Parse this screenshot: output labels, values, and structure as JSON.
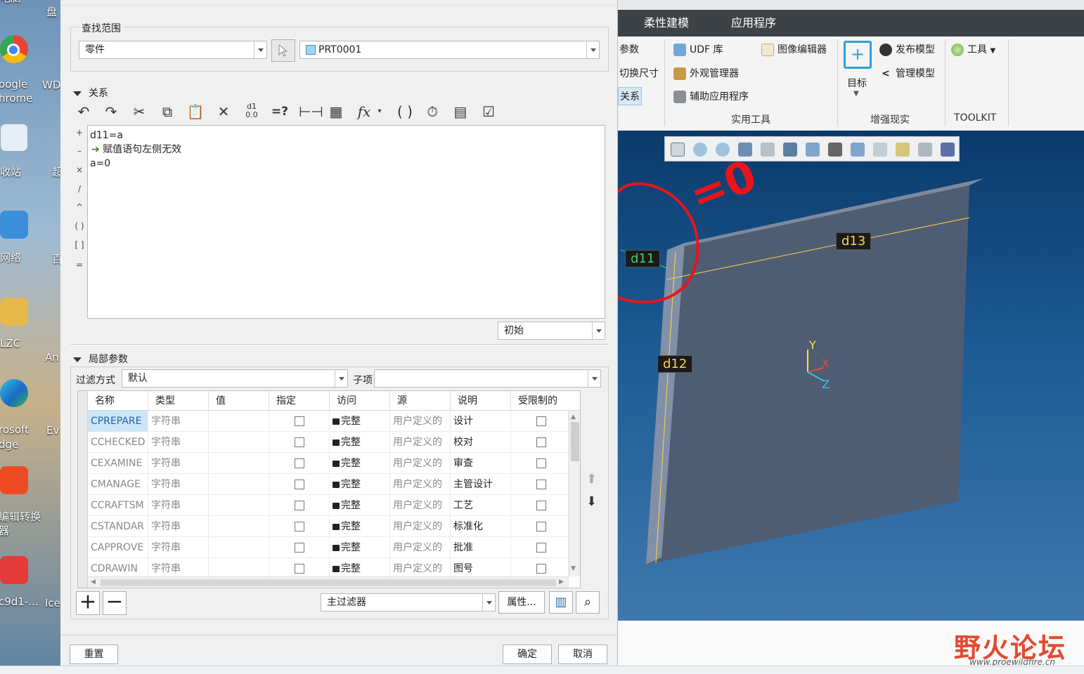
{
  "desktop": {
    "icons": [
      {
        "label": "电脑",
        "name": "desktop-icon-computer"
      },
      {
        "label": "oogle\nhrome",
        "name": "desktop-icon-chrome"
      },
      {
        "label": "收站",
        "name": "desktop-icon-recycle-bin"
      },
      {
        "label": "网络",
        "name": "desktop-icon-network"
      },
      {
        "label": "LZC",
        "name": "desktop-icon-user"
      },
      {
        "label": "rosoft\ndge",
        "name": "desktop-icon-edge"
      },
      {
        "label": "编辑转换\n器",
        "name": "desktop-icon-converter"
      },
      {
        "label": "c9d1-...",
        "name": "desktop-icon-file"
      }
    ],
    "col2": [
      "盘",
      "WD",
      "超",
      "百",
      "An",
      "Ev",
      "Ice"
    ]
  },
  "dialog": {
    "search_scope": {
      "title": "查找范围",
      "type_value": "零件",
      "model_value": "PRT0001"
    },
    "relations": {
      "title": "关系",
      "toolbar": [
        "undo-icon",
        "redo-icon",
        "cut-icon",
        "copy-icon",
        "paste-icon",
        "delete-icon",
        "insert-dims-icon",
        "evaluate-icon",
        "measure-icon",
        "sort-icon",
        "function-icon",
        "parens-icon",
        "verify-icon",
        "display-icon",
        "check-icon"
      ],
      "operators": [
        "+",
        "–",
        "×",
        "/",
        "^",
        "( )",
        "[ ]",
        "="
      ],
      "lines": [
        "d11=a",
        "赋值语句左侧无效",
        "a=0"
      ],
      "initial_value": "初始"
    },
    "local_params": {
      "title": "局部参数",
      "filter_label": "过滤方式",
      "filter_value": "默认",
      "child_label": "子项",
      "child_value": "",
      "columns": [
        "名称",
        "类型",
        "值",
        "指定",
        "访问",
        "源",
        "说明",
        "受限制的"
      ],
      "rows": [
        {
          "name": "CPREPARE",
          "type": "字符串",
          "access": "完整",
          "source": "用户定义的",
          "desc": "设计"
        },
        {
          "name": "CCHECKED",
          "type": "字符串",
          "access": "完整",
          "source": "用户定义的",
          "desc": "校对"
        },
        {
          "name": "CEXAMINE",
          "type": "字符串",
          "access": "完整",
          "source": "用户定义的",
          "desc": "审查"
        },
        {
          "name": "CMANAGE",
          "type": "字符串",
          "access": "完整",
          "source": "用户定义的",
          "desc": "主管设计"
        },
        {
          "name": "CCRAFTSM",
          "type": "字符串",
          "access": "完整",
          "source": "用户定义的",
          "desc": "工艺"
        },
        {
          "name": "CSTANDAR",
          "type": "字符串",
          "access": "完整",
          "source": "用户定义的",
          "desc": "标准化"
        },
        {
          "name": "CAPPROVE",
          "type": "字符串",
          "access": "完整",
          "source": "用户定义的",
          "desc": "批准"
        },
        {
          "name": "CDRAWIN",
          "type": "字符串",
          "access": "完整",
          "source": "用户定义的",
          "desc": "图号"
        }
      ],
      "main_filter": "主过滤器",
      "properties_label": "属性..."
    },
    "footer": {
      "reset": "重置",
      "ok": "确定",
      "cancel": "取消"
    }
  },
  "app": {
    "tabs": [
      "柔性建模",
      "应用程序"
    ],
    "left_cut": [
      "参数",
      "切换尺寸",
      "关系"
    ],
    "utilities": {
      "items": [
        "UDF 库",
        "外观管理器",
        "辅助应用程序",
        "图像编辑器"
      ],
      "label": "实用工具"
    },
    "ar": {
      "target": "目标",
      "publish": "发布模型",
      "manage": "管理模型",
      "label": "增强现实"
    },
    "toolkit": {
      "tools": "工具",
      "label": "TOOLKIT"
    },
    "dims": [
      "d11",
      "d13",
      "d12"
    ],
    "axes": [
      "Y",
      "X",
      "Z"
    ],
    "annotation": "=0"
  },
  "watermark": {
    "brand": "野火论坛",
    "url": "www.proewildfire.cn"
  },
  "colors": {
    "ribbon_dark": "#3d4246",
    "dim_yellow": "#ffd24a",
    "annotation_red": "#e8141e",
    "selection_blue": "#cde6f7"
  }
}
